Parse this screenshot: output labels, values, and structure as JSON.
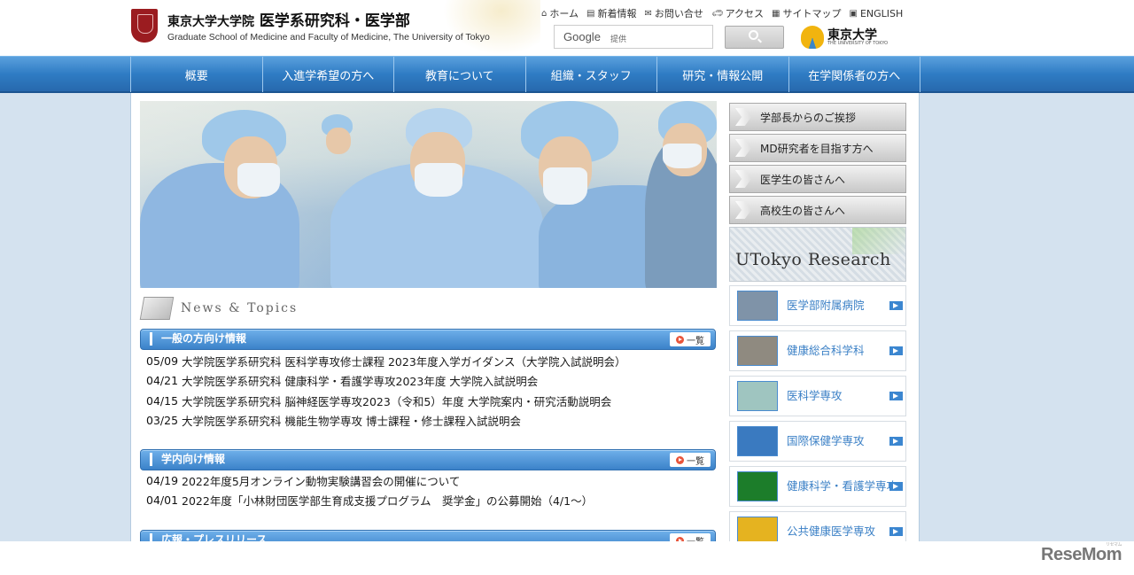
{
  "header": {
    "title_jp": "東京大学大学院",
    "title_jp_main": "医学系研究科・医学部",
    "title_en": "Graduate School of Medicine and Faculty of Medicine, The University of Tokyo",
    "util_links": [
      {
        "icon": "home-icon",
        "label": "ホーム"
      },
      {
        "icon": "document-icon",
        "label": "新着情報"
      },
      {
        "icon": "mail-icon",
        "label": "お問い合せ"
      },
      {
        "icon": "car-icon",
        "label": "アクセス"
      },
      {
        "icon": "sitemap-icon",
        "label": "サイトマップ"
      },
      {
        "icon": "language-icon",
        "label": "ENGLISH"
      }
    ],
    "search_brand": "Google",
    "search_brand_sub": "提供",
    "utokyo_label": "東京大学",
    "utokyo_sub": "THE UNIVERSITY OF TOKYO"
  },
  "nav": [
    "概要",
    "入進学希望の方へ",
    "教育について",
    "組織・スタッフ",
    "研究・情報公開",
    "在学関係者の方へ"
  ],
  "news": {
    "title": "News & Topics",
    "sections": [
      {
        "label": "一般の方向け情報",
        "more": "一覧",
        "items": [
          {
            "date": "05/09",
            "text": "大学院医学系研究科 医科学専攻修士課程 2023年度入学ガイダンス（大学院入試説明会）"
          },
          {
            "date": "04/21",
            "text": "大学院医学系研究科 健康科学・看護学専攻2023年度 大学院入試説明会"
          },
          {
            "date": "04/15",
            "text": "大学院医学系研究科 脳神経医学専攻2023（令和5）年度 大学院案内・研究活動説明会"
          },
          {
            "date": "03/25",
            "text": "大学院医学系研究科 機能生物学専攻 博士課程・修士課程入試説明会"
          }
        ]
      },
      {
        "label": "学内向け情報",
        "more": "一覧",
        "items": [
          {
            "date": "04/19",
            "text": "2022年度5月オンライン動物実験講習会の開催について"
          },
          {
            "date": "04/01",
            "text": "2022年度「小林財団医学部生育成支援プログラム　奨学金」の公募開始（4/1～）"
          }
        ]
      },
      {
        "label": "広報・プレスリリース",
        "more": "一覧",
        "items": []
      }
    ]
  },
  "sidebar": {
    "buttons": [
      "学部長からのご挨拶",
      "MD研究者を目指す方へ",
      "医学生の皆さんへ",
      "高校生の皆さんへ"
    ],
    "research_banner": "UTokyo Research",
    "departments": [
      {
        "label": "医学部附属病院",
        "color": "#7f93a8"
      },
      {
        "label": "健康総合科学科",
        "color": "#8f8a80"
      },
      {
        "label": "医科学専攻",
        "color": "#9fc5c0"
      },
      {
        "label": "国際保健学専攻",
        "color": "#3a7ac0"
      },
      {
        "label": "健康科学・看護学専攻",
        "color": "#1c7d2a"
      },
      {
        "label": "公共健康医学専攻",
        "color": "#e5b320"
      }
    ]
  },
  "watermark": "ReseMom",
  "watermark_sub": "リセマム"
}
